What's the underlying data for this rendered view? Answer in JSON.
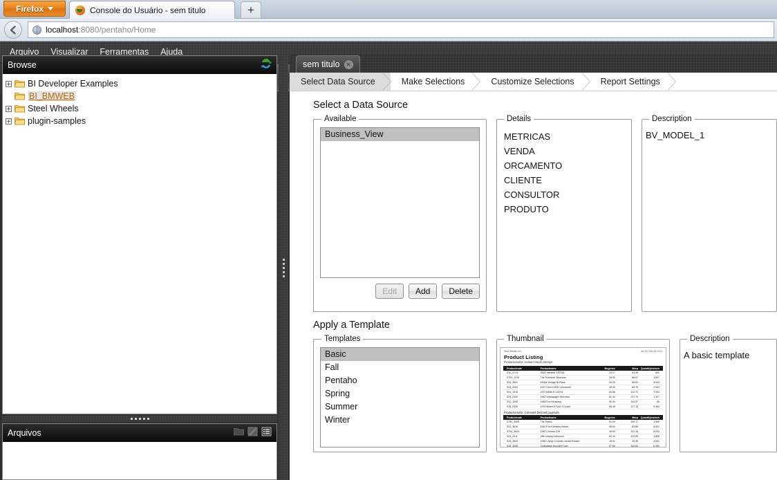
{
  "browser": {
    "firefox_button": "Firefox",
    "tab_title": "Console do Usuário - sem titulo",
    "new_tab_label": "+",
    "url_host": "localhost",
    "url_path": ":8080/pentaho/Home"
  },
  "menubar": {
    "items": [
      "Arquivo",
      "Visualizar",
      "Ferramentas",
      "Ajuda"
    ]
  },
  "toolbar": {
    "buttons": [
      {
        "name": "open-folder-icon",
        "enabled": true
      },
      {
        "name": "new-report-icon",
        "enabled": true
      },
      {
        "name": "new-analysis-icon",
        "enabled": true
      },
      {
        "name": "new-plugin-icon",
        "enabled": true
      },
      {
        "name": "edit-pencil-icon",
        "enabled": true
      },
      {
        "name": "save-icon",
        "enabled": false
      },
      {
        "name": "save-as-icon",
        "enabled": false
      },
      {
        "name": "workspace-icon",
        "enabled": true
      },
      {
        "name": "toggle-browser-icon",
        "enabled": true,
        "active": true
      }
    ]
  },
  "browse_panel": {
    "title": "Browse",
    "refresh_icon": "refresh-icon",
    "tree": [
      {
        "label": "BI Developer Examples",
        "expandable": true,
        "selected": false
      },
      {
        "label": "BI_BMWEB",
        "expandable": false,
        "selected": true
      },
      {
        "label": "Steel Wheels",
        "expandable": true,
        "selected": false
      },
      {
        "label": "plugin-samples",
        "expandable": true,
        "selected": false
      }
    ]
  },
  "files_panel": {
    "title": "Arquivos",
    "icons": [
      "folder-view-icon",
      "detail-view-icon",
      "list-view-icon"
    ]
  },
  "document_tab": {
    "label": "sem titulo",
    "close_label": "×"
  },
  "wizard": {
    "steps": [
      {
        "label": "Select Data Source",
        "current": true
      },
      {
        "label": "Make Selections",
        "current": false
      },
      {
        "label": "Customize Selections",
        "current": false
      },
      {
        "label": "Report Settings",
        "current": false
      }
    ]
  },
  "data_source": {
    "heading": "Select a Data Source",
    "available_legend": "Available",
    "available_items": [
      {
        "label": "Business_View",
        "selected": true
      }
    ],
    "buttons": [
      {
        "label": "Edit",
        "enabled": false
      },
      {
        "label": "Add",
        "enabled": true
      },
      {
        "label": "Delete",
        "enabled": true
      }
    ],
    "details_legend": "Details",
    "details_items": [
      "METRICAS",
      "VENDA",
      "ORCAMENTO",
      "CLIENTE",
      "CONSULTOR",
      "PRODUTO"
    ],
    "description_legend": "Description",
    "description_text": "BV_MODEL_1"
  },
  "template": {
    "heading": "Apply a Template",
    "templates_legend": "Templates",
    "templates": [
      {
        "label": "Basic",
        "selected": true
      },
      {
        "label": "Fall",
        "selected": false
      },
      {
        "label": "Pentaho",
        "selected": false
      },
      {
        "label": "Spring",
        "selected": false
      },
      {
        "label": "Summer",
        "selected": false
      },
      {
        "label": "Winter",
        "selected": false
      }
    ],
    "thumbnail_legend": "Thumbnail",
    "description_legend": "Description",
    "description_text": "A basic template",
    "thumbnail": {
      "company": "Steel Wheels, Inc.",
      "date": "Jun 15, 2011 @ 10:21",
      "title": "Product Listing",
      "subtitle": "Productvendor: Autoart Studio Design",
      "columns": [
        "Productcode",
        "Productname",
        "Buyprice",
        "Msrp",
        "Quantityinstock"
      ],
      "rows_1": [
        [
          "S10_4713",
          "2002 Yamaha YZR M1",
          "34.17",
          "81.36",
          "600"
        ],
        [
          "S700_1138",
          "The Schooner Bluenose",
          "34.00",
          "66.67",
          "1,897"
        ],
        [
          "S24_2841",
          "1900s Vintage Bi-Plane",
          "34.25",
          "68.51",
          "5,942"
        ],
        [
          "S24_3420",
          "1937 Horch 930V Limousine",
          "28.30",
          "65.75",
          "2,902"
        ],
        [
          "S24_1578",
          "1997 BMW R 1100 S",
          "60.86",
          "112.70",
          "7,003"
        ],
        [
          "S24_2300",
          "1962 Volkswagen Microbus",
          "61.34",
          "127.79",
          "1,327"
        ],
        [
          "S12_1099",
          "1968 Ford Mustang",
          "95.34",
          "194.57",
          "68"
        ],
        [
          "S18_2325",
          "1932 Model A Ford J-Coupe",
          "58.48",
          "127.13",
          "9,354"
        ]
      ],
      "section_2": "Productvendor: Carousel DieCast Legends",
      "rows_2": [
        [
          "S700_3505",
          "The Titanic",
          "51.09",
          "100.17",
          "1,956"
        ],
        [
          "S24_3816",
          "1940 Ford Delivery Sedan",
          "48.64",
          "83.86",
          "6,621"
        ],
        [
          "S700_3624",
          "1982 Camaro Z28",
          "46.53",
          "101.15",
          "6,934"
        ],
        [
          "S24_2011",
          "18th century schooner",
          "82.34",
          "122.89",
          "1,898"
        ],
        [
          "S24_2840",
          "1958 Chevy Corvette Limited Edition",
          "15.91",
          "35.36",
          "2,542"
        ],
        [
          "S18_3259",
          "Collectable Wooden Train",
          "67.56",
          "100.84",
          "6,450"
        ]
      ]
    }
  }
}
